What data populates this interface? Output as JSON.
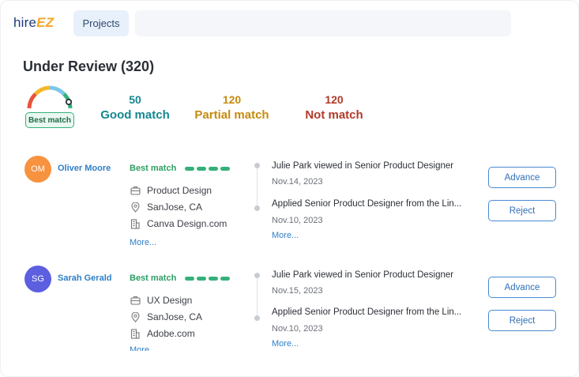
{
  "app": {
    "logo_hire": "hire",
    "logo_ez": "EZ"
  },
  "nav": {
    "projects_label": "Projects"
  },
  "page": {
    "title": "Under Review (320)"
  },
  "gauge": {
    "badge": "Best match"
  },
  "stats": {
    "good": {
      "count": "50",
      "label": "Good match"
    },
    "partial": {
      "count": "120",
      "label": "Partial match"
    },
    "not": {
      "count": "120",
      "label": "Not match"
    }
  },
  "colors": {
    "good": "#13878f",
    "partial": "#c68a0f",
    "not": "#b23a2a",
    "match_green": "#35b07a",
    "link_blue": "#2f7fc7"
  },
  "candidates": [
    {
      "initials": "OM",
      "avatar_color": "#f7923f",
      "name": "Oliver Moore",
      "match": "Best match",
      "role": "Product Design",
      "location": "SanJose, CA",
      "company": "Canva Design.com",
      "more": "More...",
      "activity": [
        {
          "text": "Julie Park viewed in Senior Product Designer",
          "date": "Nov.14, 2023"
        },
        {
          "text": "Applied Senior Product Designer from the Lin...",
          "date": "Nov.10, 2023"
        }
      ],
      "activity_more": "More...",
      "advance_label": "Advance",
      "reject_label": "Reject"
    },
    {
      "initials": "SG",
      "avatar_color": "#5b5fe0",
      "name": "Sarah Gerald",
      "match": "Best match",
      "role": "UX Design",
      "location": "SanJose, CA",
      "company": "Adobe.com",
      "more": "More...",
      "activity": [
        {
          "text": "Julie Park viewed in Senior Product Designer",
          "date": "Nov.15, 2023"
        },
        {
          "text": "Applied Senior Product Designer from the Lin...",
          "date": "Nov.10, 2023"
        }
      ],
      "activity_more": "More...",
      "advance_label": "Advance",
      "reject_label": "Reject"
    }
  ],
  "icons": {
    "role": "briefcase-icon",
    "location": "map-pin-icon",
    "company": "building-icon"
  }
}
